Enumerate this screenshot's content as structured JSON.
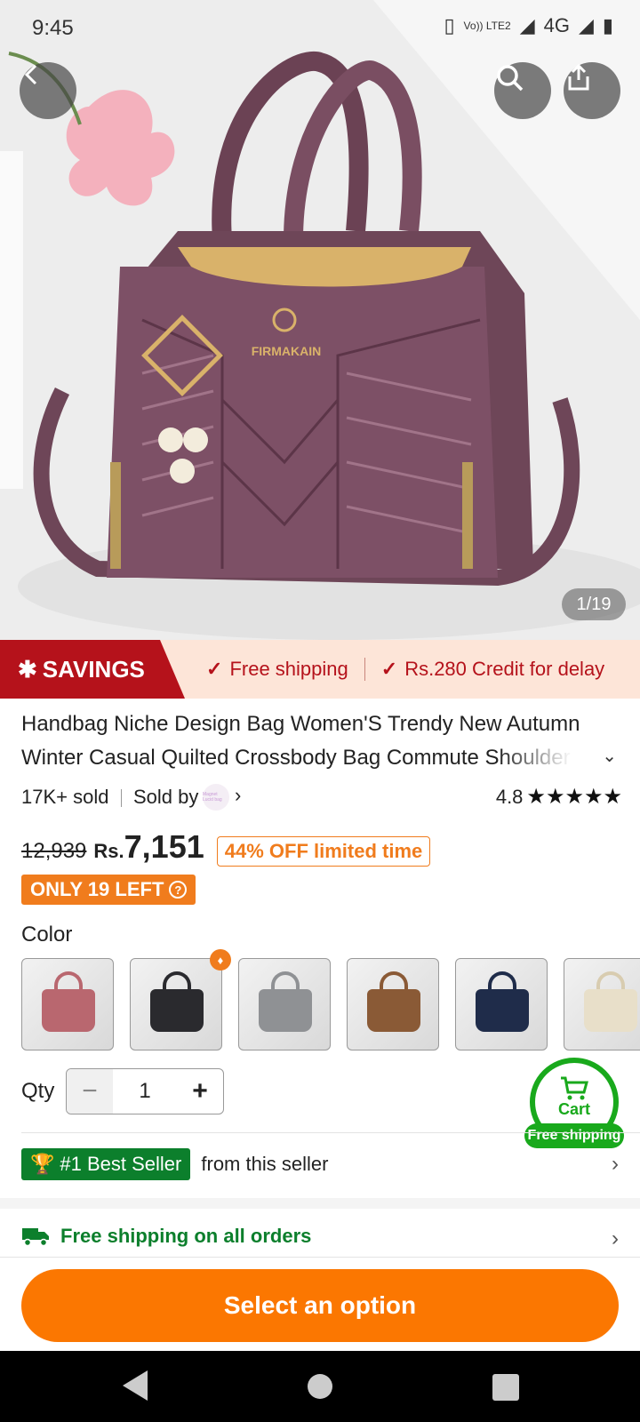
{
  "status": {
    "time": "9:45",
    "network": "4G",
    "volte": "Vo)) LTE2"
  },
  "image": {
    "counter": "1/19",
    "brand_text": "FIRMAKAIN"
  },
  "savings": {
    "badge": "SAVINGS",
    "perks": [
      "Free shipping",
      "Rs.280 Credit for delay"
    ]
  },
  "product": {
    "title": "Handbag Niche Design Bag Women'S Trendy New Autumn Winter Casual Quilted Crossbody Bag Commute Shoulder Bag",
    "sold": "17K+ sold",
    "sold_by": "Sold by",
    "seller_logo_text": "Magnet Lucid bag",
    "rating": "4.8",
    "original_price": "12,939",
    "currency": "Rs.",
    "price": "7,151",
    "discount": "44% OFF limited time",
    "stock": "ONLY 19 LEFT"
  },
  "colors": {
    "label": "Color",
    "options": [
      {
        "name": "pink",
        "color": "#b9676f"
      },
      {
        "name": "black",
        "color": "#2a2a2e"
      },
      {
        "name": "gray",
        "color": "#8f9194"
      },
      {
        "name": "brown",
        "color": "#8a5a36"
      },
      {
        "name": "navy",
        "color": "#1f2c4a"
      },
      {
        "name": "beige",
        "color": "#e8dfc9"
      }
    ]
  },
  "qty": {
    "label": "Qty",
    "value": "1"
  },
  "cart": {
    "label": "Cart",
    "badge": "Free shipping"
  },
  "bestseller": {
    "badge": "#1 Best Seller",
    "text": "from this seller"
  },
  "shipping": {
    "text": "Free shipping on all orders"
  },
  "cta": {
    "label": "Select an option"
  },
  "theme": {
    "accent": "#fb7701",
    "savings_red": "#b5121b",
    "green": "#0c7f2c"
  }
}
